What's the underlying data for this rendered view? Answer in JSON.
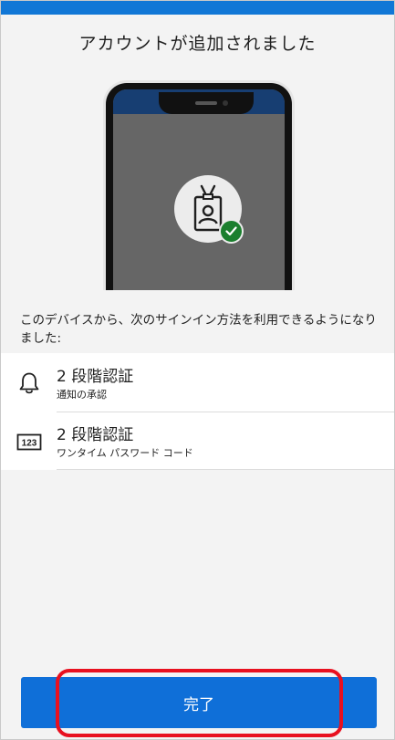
{
  "page": {
    "title": "アカウントが追加されました",
    "description": "このデバイスから、次のサインイン方法を利用できるようになりました:"
  },
  "illustration": {
    "icons": [
      "id-badge-icon",
      "checkmark-icon"
    ],
    "colors": {
      "status_bar": "#173e72",
      "screen": "#666666",
      "check_badge": "#1b7f2e"
    }
  },
  "methods": [
    {
      "icon": "bell-icon",
      "title": "2 段階認証",
      "subtitle": "通知の承認"
    },
    {
      "icon": "numeric-code-icon",
      "icon_text": "123",
      "title": "2 段階認証",
      "subtitle": "ワンタイム パスワード コード"
    }
  ],
  "actions": {
    "done_label": "完了"
  },
  "colors": {
    "accent": "#0f6fd8",
    "top_bar": "#1177d6",
    "highlight": "#e8101f",
    "background": "#f3f3f3"
  }
}
